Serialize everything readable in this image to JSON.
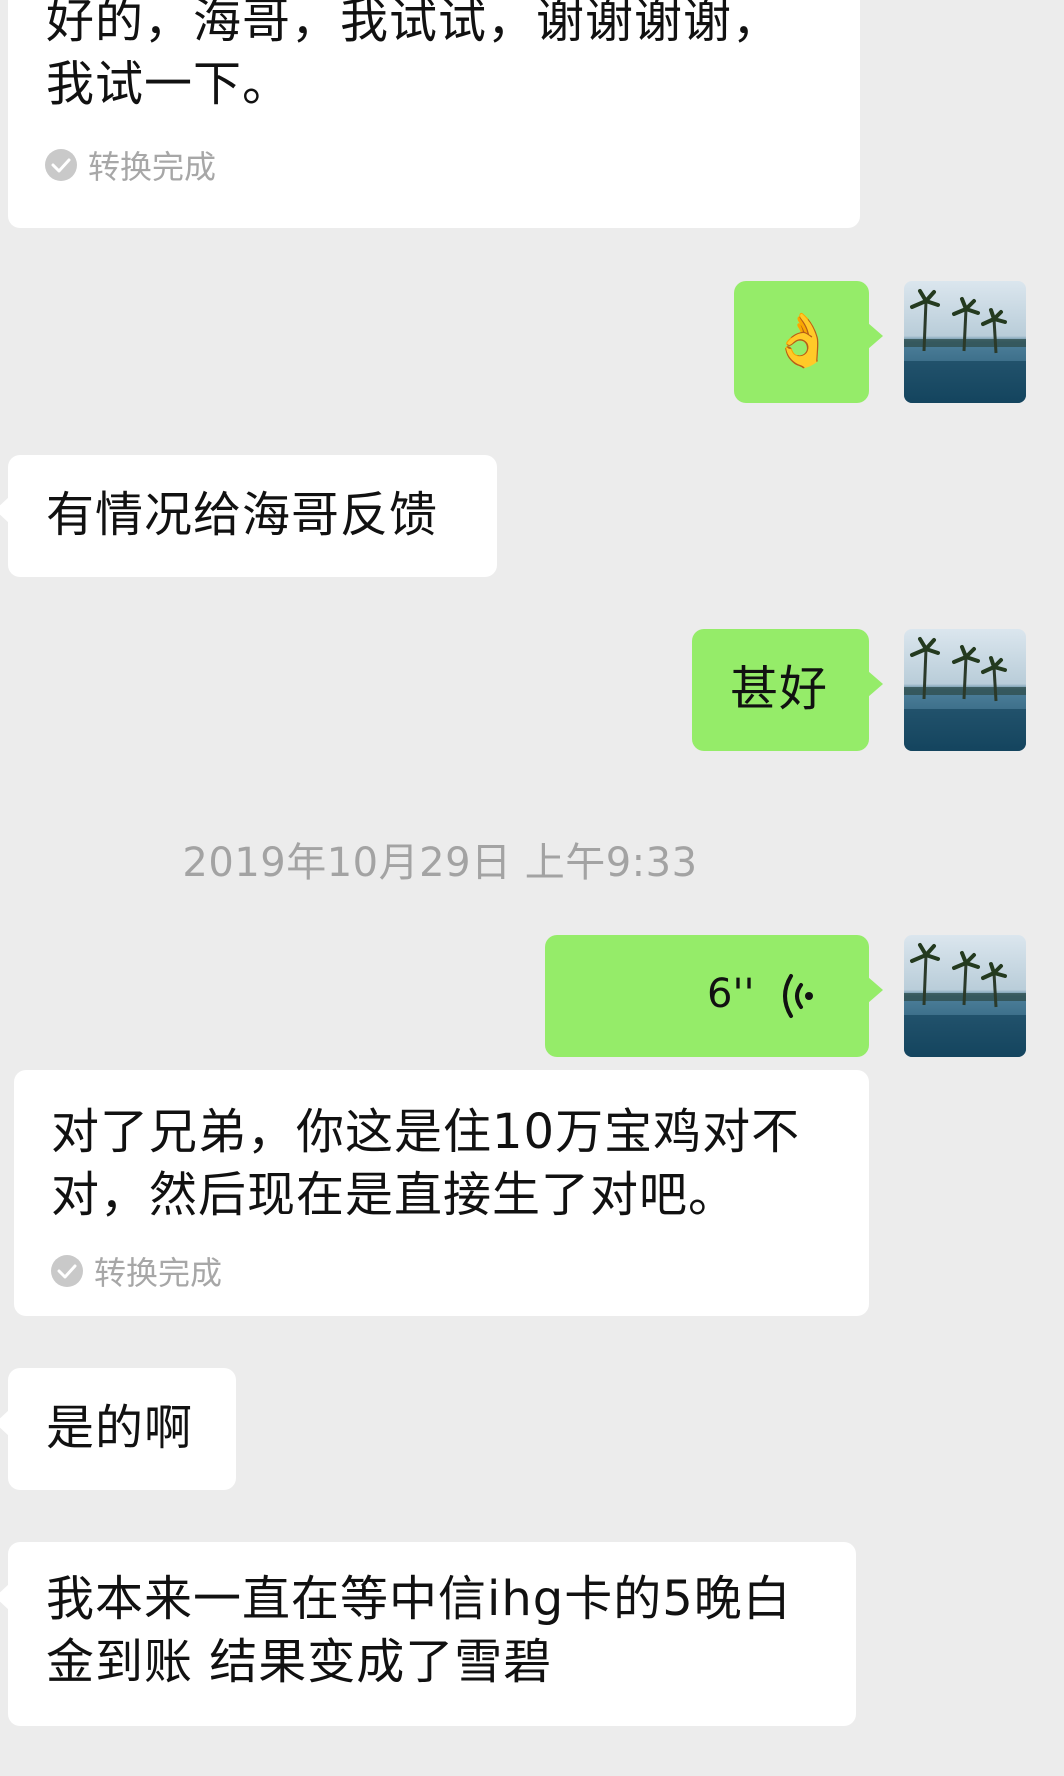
{
  "messages": [
    {
      "id": "m1",
      "side": "incoming",
      "text": "好的，海哥，我试试，谢谢谢谢，\n我试一下。",
      "status": "转换完成"
    },
    {
      "id": "m2",
      "side": "outgoing",
      "emoji": "👌"
    },
    {
      "id": "m3",
      "side": "incoming",
      "text": "有情况给海哥反馈"
    },
    {
      "id": "m4",
      "side": "outgoing",
      "text": "甚好"
    },
    {
      "id": "m5",
      "side": "outgoing",
      "type": "voice",
      "duration": "6''"
    },
    {
      "id": "m6",
      "side": "outgoing",
      "text": "对了兄弟，你这是住10万宝鸡对不\n对，然后现在是直接生了对吧。",
      "status": "转换完成"
    },
    {
      "id": "m7",
      "side": "incoming",
      "text": "是的啊"
    },
    {
      "id": "m8",
      "side": "incoming",
      "text": "我本来一直在等中信ihg卡的5晚白\n金到账 结果变成了雪碧"
    }
  ],
  "timestamp": "2019年10月29日 上午9:33",
  "icons": {
    "status_check": "check-circle-icon",
    "voice": "voice-wave-icon",
    "avatar": "avatar-image"
  },
  "colors": {
    "background": "#ececec",
    "incoming_bubble": "#ffffff",
    "outgoing_bubble": "#95ec69",
    "status_text": "#a7a7a7",
    "timestamp_text": "#a3a3a3"
  }
}
